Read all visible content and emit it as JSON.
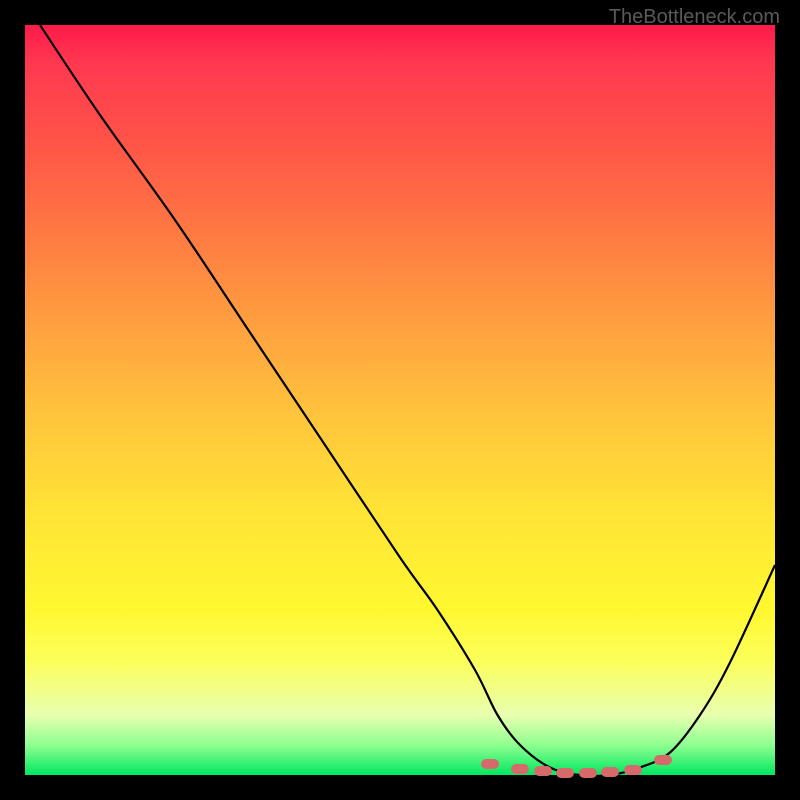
{
  "attribution": "TheBottleneck.com",
  "chart_data": {
    "type": "line",
    "title": "",
    "xlabel": "",
    "ylabel": "",
    "xlim": [
      0,
      100
    ],
    "ylim": [
      0,
      100
    ],
    "series": [
      {
        "name": "bottleneck-curve",
        "x": [
          2,
          10,
          20,
          30,
          40,
          50,
          55,
          60,
          63,
          66,
          70,
          74,
          78,
          82,
          86,
          90,
          94,
          100
        ],
        "values": [
          100,
          88,
          74,
          59,
          44,
          29,
          22,
          14,
          8,
          4,
          1,
          0,
          0,
          1,
          3,
          8,
          15,
          28
        ]
      }
    ],
    "markers": {
      "name": "optimal-range-markers",
      "points": [
        {
          "x": 62,
          "y": 1.5
        },
        {
          "x": 66,
          "y": 0.8
        },
        {
          "x": 69,
          "y": 0.5
        },
        {
          "x": 72,
          "y": 0.3
        },
        {
          "x": 75,
          "y": 0.3
        },
        {
          "x": 78,
          "y": 0.4
        },
        {
          "x": 81,
          "y": 0.7
        },
        {
          "x": 85,
          "y": 2.0
        }
      ]
    },
    "background": {
      "type": "vertical-gradient",
      "stops": [
        {
          "pos": 0,
          "color": "#ff1a4a"
        },
        {
          "pos": 100,
          "color": "#00e860"
        }
      ]
    }
  }
}
